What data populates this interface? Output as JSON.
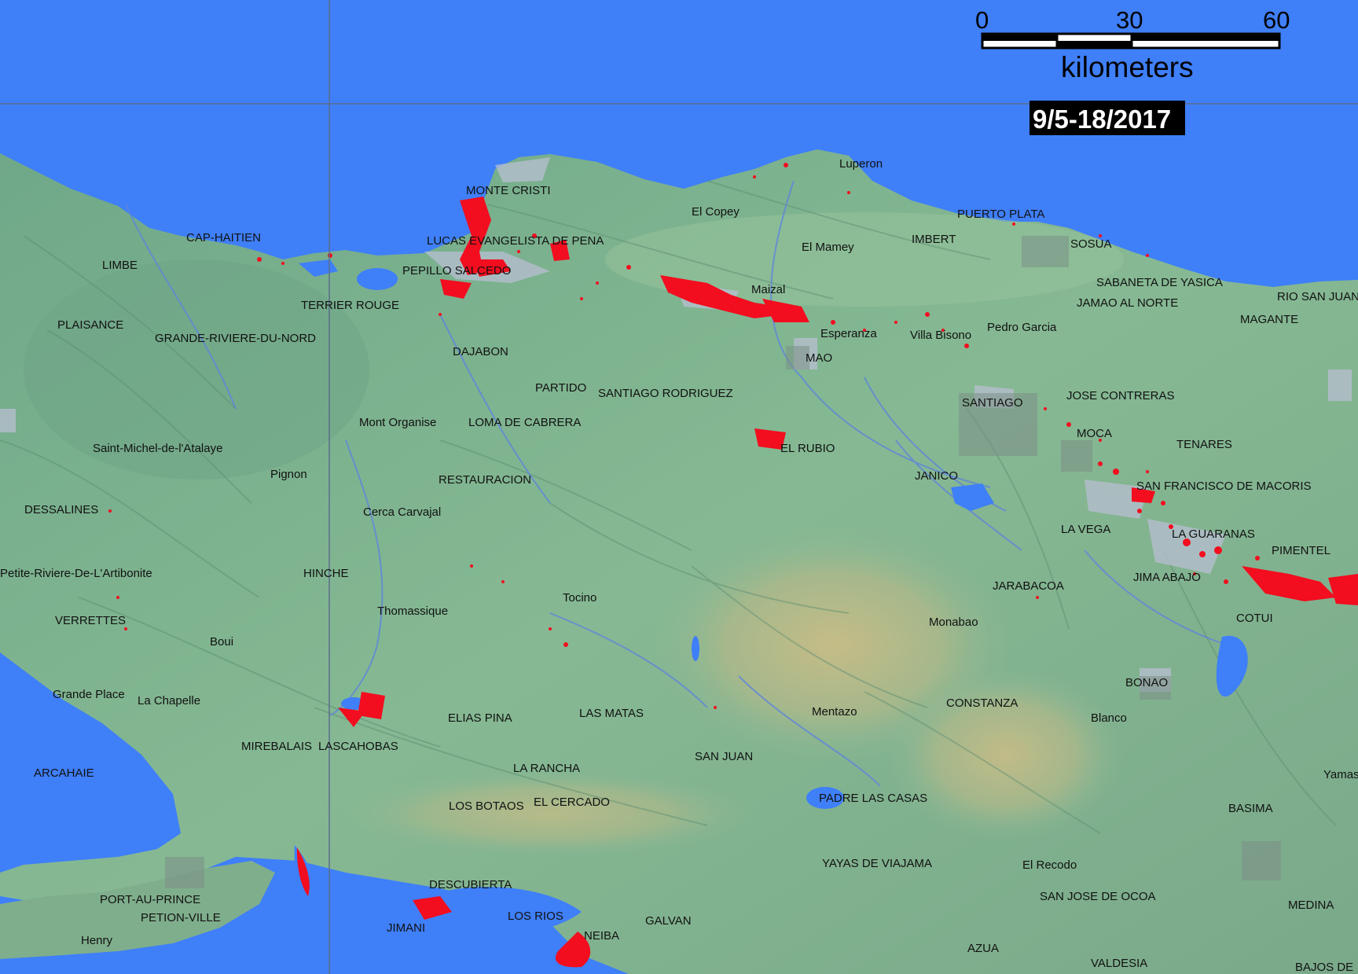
{
  "date_label": "9/5-18/2017",
  "scale_bar": {
    "ticks": [
      "0",
      "30",
      "60"
    ],
    "unit": "kilometers"
  },
  "colors": {
    "water": "#3f7ff8",
    "land_low": "#79b08e",
    "land_mid": "#8fbe96",
    "highland": "#c4bb84",
    "flood": "#f20d1f",
    "normal_water_light": "#b8bfd2"
  },
  "places": [
    "MONTE CRISTI",
    "Luperon",
    "El Copey",
    "PUERTO PLATA",
    "CAP-HAITIEN",
    "LUCAS EVANGELISTA DE PENA",
    "El Mamey",
    "IMBERT",
    "SOSUA",
    "LIMBE",
    "PEPILLO SALCEDO",
    "SABANETA DE YASICA",
    "Maizal",
    "TERRIER ROUGE",
    "JAMAO AL NORTE",
    "RIO SAN JUAN",
    "PLAISANCE",
    "Esperanza",
    "Villa Bisono",
    "Pedro Garcia",
    "MAGANTE",
    "GRANDE-RIVIERE-DU-NORD",
    "MAO",
    "DAJABON",
    "PARTIDO",
    "SANTIAGO RODRIGUEZ",
    "JOSE CONTRERAS",
    "SANTIAGO",
    "Mont Organise",
    "LOMA DE CABRERA",
    "MOCA",
    "TENARES",
    "Saint-Michel-de-l'Atalaye",
    "EL RUBIO",
    "Pignon",
    "JANICO",
    "RESTAURACION",
    "SAN FRANCISCO DE MACORIS",
    "DESSALINES",
    "Cerca Carvajal",
    "LA VEGA",
    "LA GUARANAS",
    "PIMENTEL",
    "Petite-Riviere-De-L'Artibonite",
    "HINCHE",
    "JIMA ABAJO",
    "JARABACOA",
    "Tocino",
    "Thomassique",
    "COTUI",
    "Monabao",
    "VERRETTES",
    "Boui",
    "BONAO",
    "Grande Place",
    "La Chapelle",
    "CONSTANZA",
    "LAS MATAS",
    "Mentazo",
    "Blanco",
    "ELIAS PINA",
    "MIREBALAIS",
    "LASCAHOBAS",
    "SAN JUAN",
    "ARCAHAIE",
    "LA RANCHA",
    "Yamas",
    "LOS BOTAOS",
    "EL CERCADO",
    "PADRE LAS CASAS",
    "BASIMA",
    "YAYAS DE VIAJAMA",
    "El Recodo",
    "PORT-AU-PRINCE",
    "DESCUBIERTA",
    "SAN JOSE DE OCOA",
    "MEDINA",
    "PETION-VILLE",
    "LOS RIOS",
    "GALVAN",
    "JIMANI",
    "NEIBA",
    "Henry",
    "AZUA",
    "VALDESIA",
    "BAJOS DE"
  ]
}
